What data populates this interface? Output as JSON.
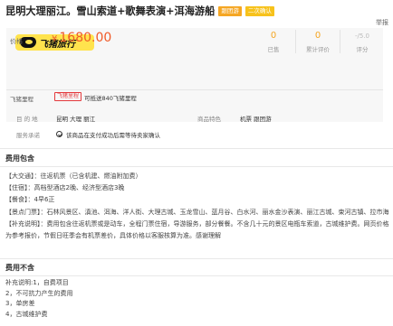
{
  "header": {
    "title": "昆明大理丽江。雪山索道+歌舞表演+洱海游船",
    "tags": [
      "跟团游",
      "二次确认"
    ],
    "report": "举报"
  },
  "brand": {
    "logo_text": "飞猪旅行"
  },
  "price": {
    "label": "价格",
    "currency": "¥",
    "amount": "1680.00"
  },
  "stats": [
    {
      "value": "0",
      "label": "已售"
    },
    {
      "value": "0",
      "label": "累计评价"
    },
    {
      "value": "-/5.0",
      "label": "评分"
    }
  ],
  "cert": {
    "label": "飞猪里程",
    "badge": "飞猪里程",
    "text": "可抵送840飞猪里程"
  },
  "info": {
    "destination_label": "目 的 地",
    "destination_value": "昆明  大理  丽江",
    "features_label": "商品特色",
    "features_value": "机票  跟团游",
    "service_label": "服务承诺",
    "service_value": "该商品在支付成功后需等待卖家确认"
  },
  "fee_include": {
    "title": "费用包含",
    "lines": [
      "【大交通】：往返机票（已含机建、燃油附加费）",
      "【住宿】：高档型酒店2晚、经济型酒店3晚",
      "【餐食】：4早6正",
      "【景点门票】：石林风景区、滇池、洱海、洋人街、大理古城、玉龙雪山、蓝月谷、白水河、丽水金沙表演、丽江古城、束河古镇、拉市海",
      "【补充说明】：费用包含往返机票或是动车，全程门票住宿，导游服务，部分餐餐。不含几十元的景区电瓶车索道，古城维护费。网页价格为参考报价，节假日旺季会有机票差价，具体价格以客服核算为准。感谢理解"
    ]
  },
  "fee_exclude": {
    "title": "费用不含",
    "lines": [
      "补充说明:1，自费项目",
      "2，不可抗力产生的费用",
      "3，单房差",
      "4，古城维护费"
    ]
  }
}
